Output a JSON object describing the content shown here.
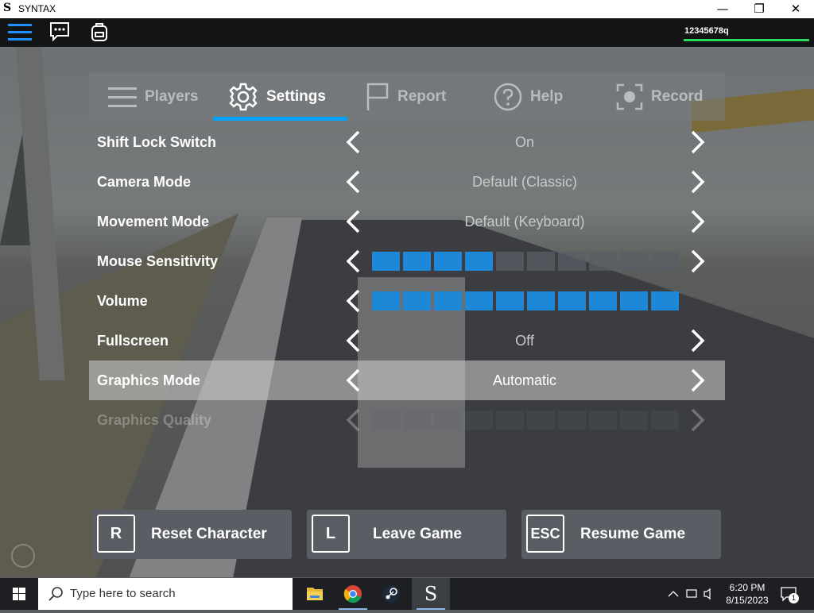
{
  "window": {
    "logo": "S",
    "title": "SYNTAX",
    "minimize": "—",
    "maximize": "❐",
    "close": "✕"
  },
  "topbar": {
    "menu_icon": "hamburger-icon",
    "chat_icon": "chat-icon",
    "backpack_icon": "backpack-icon",
    "username": "12345678q",
    "health_fraction": 1.0,
    "health_color": "#29d95b"
  },
  "tabs": [
    {
      "label": "Players",
      "icon": "players-icon",
      "active": false
    },
    {
      "label": "Settings",
      "icon": "gear-icon",
      "active": true
    },
    {
      "label": "Report",
      "icon": "flag-icon",
      "active": false
    },
    {
      "label": "Help",
      "icon": "help-icon",
      "active": false
    },
    {
      "label": "Record",
      "icon": "record-icon",
      "active": false
    }
  ],
  "settings": [
    {
      "label": "Shift Lock Switch",
      "type": "select",
      "value": "On"
    },
    {
      "label": "Camera Mode",
      "type": "select",
      "value": "Default (Classic)"
    },
    {
      "label": "Movement Mode",
      "type": "select",
      "value": "Default (Keyboard)"
    },
    {
      "label": "Mouse Sensitivity",
      "type": "slider",
      "level": 4,
      "max": 10
    },
    {
      "label": "Volume",
      "type": "slider",
      "level": 10,
      "max": 10
    },
    {
      "label": "Fullscreen",
      "type": "select",
      "value": "Off"
    },
    {
      "label": "Graphics Mode",
      "type": "select",
      "value": "Automatic",
      "selected": true
    },
    {
      "label": "Graphics Quality",
      "type": "slider",
      "level": 0,
      "max": 10,
      "faded": true
    }
  ],
  "buttons": [
    {
      "key": "R",
      "label": "Reset Character"
    },
    {
      "key": "L",
      "label": "Leave Game"
    },
    {
      "key": "ESC",
      "label": "Resume Game"
    }
  ],
  "accent_color": "#00a2ff",
  "slider_on_color": "#1e88d8",
  "taskbar": {
    "search_placeholder": "Type here to search",
    "apps": [
      "file-explorer-icon",
      "chrome-icon",
      "steam-icon",
      "syntax-icon"
    ],
    "syntax_letter": "S",
    "time": "6:20 PM",
    "date": "8/15/2023",
    "notification_count": "1"
  }
}
